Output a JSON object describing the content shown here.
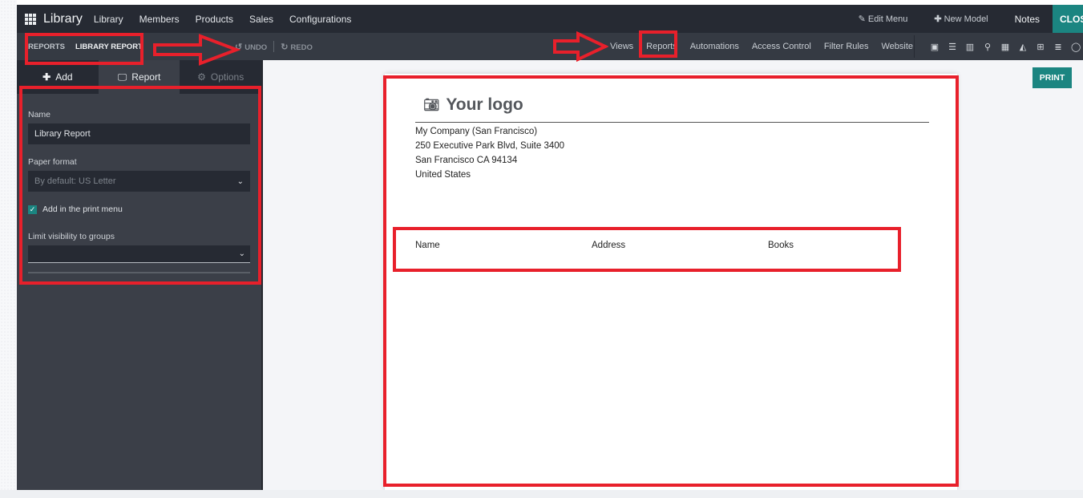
{
  "navbar": {
    "brand": "Library",
    "menu": [
      "Library",
      "Members",
      "Products",
      "Sales",
      "Configurations"
    ],
    "edit_menu": "Edit Menu",
    "new_model": "New Model",
    "notes": "Notes",
    "close": "CLOSE"
  },
  "toolbar": {
    "breadcrumb": [
      "REPORTS",
      "LIBRARY REPORT"
    ],
    "undo": "UNDO",
    "redo": "REDO",
    "menu": [
      "Views",
      "Reports",
      "Automations",
      "Access Control",
      "Filter Rules",
      "Website"
    ],
    "view_icons": [
      "form-view-icon",
      "list-view-icon",
      "kanban-view-icon",
      "map-view-icon",
      "calendar-view-icon",
      "graph-view-icon",
      "pivot-view-icon",
      "activity-view-icon",
      "search-icon"
    ]
  },
  "sidebar": {
    "tabs": [
      {
        "label": "Add",
        "icon": "plus-icon"
      },
      {
        "label": "Report",
        "icon": "monitor-icon",
        "active": true
      },
      {
        "label": "Options",
        "icon": "gear-icon",
        "disabled": true
      }
    ],
    "name_label": "Name",
    "name_value": "Library Report",
    "paper_label": "Paper format",
    "paper_placeholder": "By default: US Letter",
    "print_menu_label": "Add in the print menu",
    "print_menu_checked": true,
    "groups_label": "Limit visibility to groups",
    "groups_value": ""
  },
  "report": {
    "print_label": "PRINT",
    "logo_text": "Your logo",
    "address": [
      "My Company (San Francisco)",
      "250 Executive Park Blvd, Suite 3400",
      "San Francisco CA 94134",
      "United States"
    ],
    "columns": [
      "Name",
      "Address",
      "Books"
    ]
  },
  "colors": {
    "accent": "#1b8581",
    "navbar": "#262a33",
    "toolbar": "#353a43",
    "sidebar": "#3b3f48",
    "annotation": "#e8202b"
  }
}
